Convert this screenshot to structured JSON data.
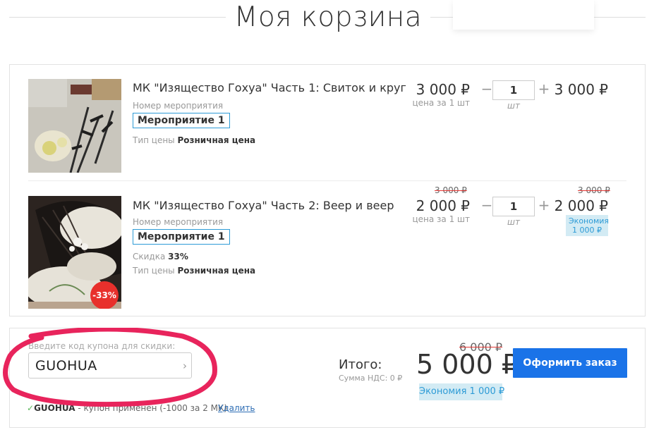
{
  "header": {
    "title": "Моя корзина"
  },
  "cart": {
    "items": [
      {
        "name": "МК \"Изящество Гохуа\" Часть 1: Свиток и круг",
        "event_number_label": "Номер мероприятия",
        "event_badge": "Мероприятие 1",
        "price_type_label": "Тип цены",
        "price_type": "Розничная цена",
        "price": "3 000 ₽",
        "unit_price_label": "цена за 1 шт",
        "quantity": "1",
        "quantity_unit": "шт",
        "sum": "3 000 ₽"
      },
      {
        "name": "МК \"Изящество Гохуа\" Часть 2: Веер и веер",
        "event_number_label": "Номер мероприятия",
        "event_badge": "Мероприятие 1",
        "discount_label": "Скидка",
        "discount": "33%",
        "price_type_label": "Тип цены",
        "price_type": "Розничная цена",
        "old_price": "3 000 ₽",
        "price": "2 000 ₽",
        "unit_price_label": "цена за 1 шт",
        "quantity": "1",
        "quantity_unit": "шт",
        "old_sum": "3 000 ₽",
        "sum": "2 000 ₽",
        "savings_label": "Экономия",
        "savings_value": "1 000 ₽",
        "discount_badge": "-33%"
      }
    ],
    "qty_minus": "−",
    "qty_plus": "+"
  },
  "coupon": {
    "label": "Введите код купона для скидки:",
    "value": "GUOHUA",
    "arrow": "›",
    "applied_check": "✓",
    "applied_code": "GUOHUA",
    "applied_text": " - купон применен (-1000 за 2 МК)",
    "delete_label": "Удалить"
  },
  "order": {
    "total_label": "Итого:",
    "vat_label": "Сумма НДС: 0 ₽",
    "old_total": "6 000 ₽",
    "total": "5 000 ₽",
    "savings": "Экономия 1 000 ₽",
    "checkout_label": "Оформить заказ"
  },
  "colors": {
    "accent": "#1a73e8",
    "badge_border": "#2d9bd6",
    "discount_red": "#e8302c",
    "savings_bg": "#d3ebf4",
    "annotation_circle": "#e8245c"
  }
}
